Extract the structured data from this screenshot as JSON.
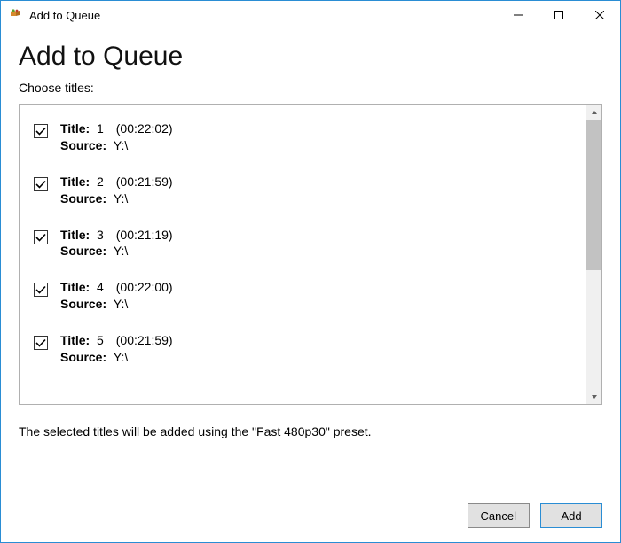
{
  "window": {
    "title": "Add to Queue"
  },
  "header": {
    "heading": "Add to Queue",
    "subheading": "Choose titles:"
  },
  "labels": {
    "title": "Title:",
    "source": "Source:"
  },
  "items": [
    {
      "checked": true,
      "number": "1",
      "duration": "(00:22:02)",
      "source": "Y:\\"
    },
    {
      "checked": true,
      "number": "2",
      "duration": "(00:21:59)",
      "source": "Y:\\"
    },
    {
      "checked": true,
      "number": "3",
      "duration": "(00:21:19)",
      "source": "Y:\\"
    },
    {
      "checked": true,
      "number": "4",
      "duration": "(00:22:00)",
      "source": "Y:\\"
    },
    {
      "checked": true,
      "number": "5",
      "duration": "(00:21:59)",
      "source": "Y:\\"
    }
  ],
  "preset_line": {
    "prefix": "The selected titles will be added using the ",
    "preset": "\"Fast 480p30\"",
    "suffix": " preset."
  },
  "buttons": {
    "cancel": "Cancel",
    "add": "Add"
  }
}
